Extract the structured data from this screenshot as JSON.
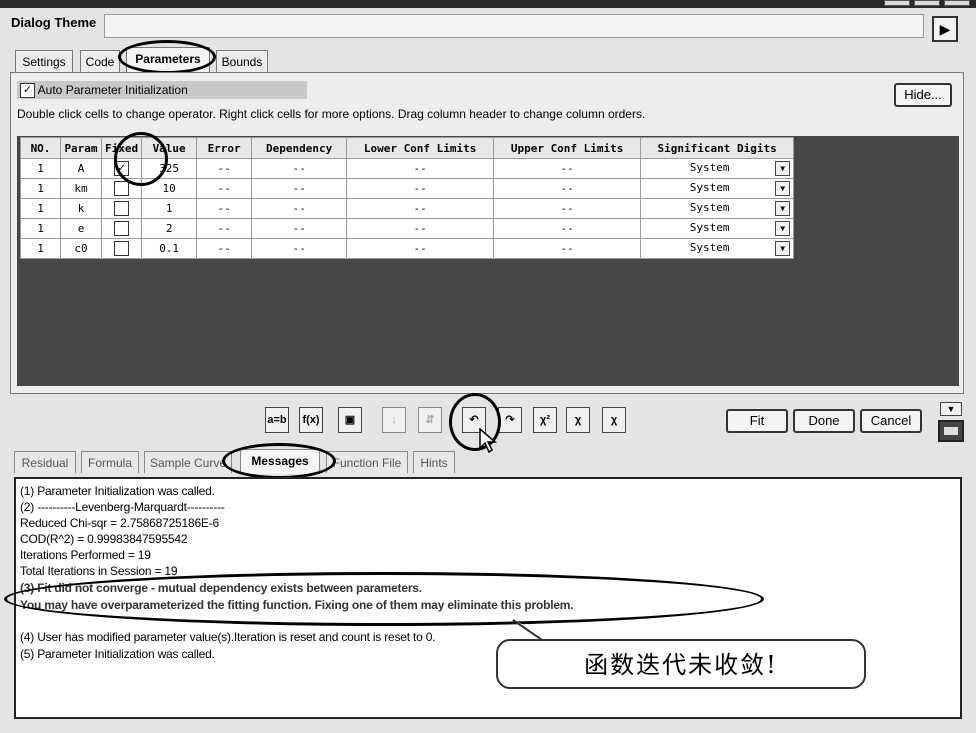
{
  "dialog_theme": {
    "label": "Dialog Theme",
    "value": "",
    "arrow": "▶"
  },
  "top_tabs": [
    "Settings",
    "Code",
    "Parameters",
    "Bounds"
  ],
  "auto_param": {
    "checked": "✓",
    "label": "Auto Parameter Initialization"
  },
  "hide_button": "Hide...",
  "hint": "Double click cells to change operator. Right click cells for more options. Drag column header to change column orders.",
  "table": {
    "headers": [
      "NO.",
      "Param",
      "Fixed",
      "Value",
      "Error",
      "Dependency",
      "Lower Conf Limits",
      "Upper Conf Limits",
      "Significant Digits"
    ],
    "rows": [
      {
        "no": "1",
        "param": "A",
        "fixed": "✓",
        "value": "325",
        "error": "--",
        "dependency": "--",
        "lower": "--",
        "upper": "--",
        "digits": "System"
      },
      {
        "no": "1",
        "param": "km",
        "fixed": "",
        "value": "10",
        "error": "--",
        "dependency": "--",
        "lower": "--",
        "upper": "--",
        "digits": "System"
      },
      {
        "no": "1",
        "param": "k",
        "fixed": "",
        "value": "1",
        "error": "--",
        "dependency": "--",
        "lower": "--",
        "upper": "--",
        "digits": "System"
      },
      {
        "no": "1",
        "param": "e",
        "fixed": "",
        "value": "2",
        "error": "--",
        "dependency": "--",
        "lower": "--",
        "upper": "--",
        "digits": "System"
      },
      {
        "no": "1",
        "param": "c0",
        "fixed": "",
        "value": "0.1",
        "error": "--",
        "dependency": "--",
        "lower": "--",
        "upper": "--",
        "digits": "System"
      }
    ]
  },
  "toolbar": {
    "icons": [
      "a=b",
      "f(x)",
      "▣",
      "↓",
      "⇵",
      "↶",
      "↷",
      "χ²",
      "χ",
      "χ"
    ],
    "fit": "Fit",
    "done": "Done",
    "cancel": "Cancel"
  },
  "bottom_tabs": [
    "Residual",
    "Formula",
    "Sample Curve",
    "Messages",
    "Function File",
    "Hints"
  ],
  "messages": [
    "(1) Parameter Initialization was called.",
    "(2) ----------Levenberg-Marquardt----------",
    "Reduced Chi-sqr = 2.75868725186E-6",
    "COD(R^2) = 0.99983847595542",
    "Iterations Performed = 19",
    "Total Iterations in Session = 19",
    "(3) Fit did not converge - mutual dependency exists between parameters.",
    "You may have overparameterized the fitting function. Fixing one of them may eliminate this problem.",
    "(4) User has modified parameter value(s).Iteration is reset and count is reset to 0.",
    "(5) Parameter Initialization was called."
  ],
  "callout": "函数迭代未收敛!"
}
